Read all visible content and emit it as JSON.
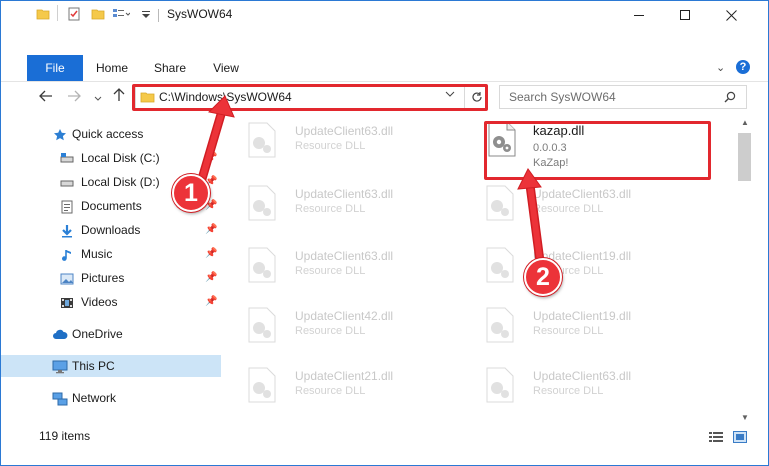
{
  "window": {
    "title": "SysWOW64",
    "controls": [
      "minimize",
      "maximize",
      "close"
    ]
  },
  "ribbon": {
    "tabs": [
      "File",
      "Home",
      "Share",
      "View"
    ]
  },
  "navigation": {
    "address": "C:\\Windows\\SysWOW64",
    "search_placeholder": "Search SysWOW64"
  },
  "sidebar": {
    "items": [
      {
        "label": "Quick access",
        "icon": "star-icon"
      },
      {
        "label": "Local Disk (C:)",
        "icon": "drive-icon"
      },
      {
        "label": "Local Disk (D:)",
        "icon": "drive-icon"
      },
      {
        "label": "Documents",
        "icon": "documents-icon"
      },
      {
        "label": "Downloads",
        "icon": "download-icon"
      },
      {
        "label": "Music",
        "icon": "music-icon"
      },
      {
        "label": "Pictures",
        "icon": "pictures-icon"
      },
      {
        "label": "Videos",
        "icon": "videos-icon"
      },
      {
        "label": "OneDrive",
        "icon": "cloud-icon"
      },
      {
        "label": "This PC",
        "icon": "computer-icon"
      },
      {
        "label": "Network",
        "icon": "network-icon"
      }
    ]
  },
  "files": [
    {
      "name": "UpdateClient63.dll",
      "desc": "Resource DLL"
    },
    {
      "name": "kazap.dll",
      "desc": "0.0.0.3",
      "desc2": "KaZap!"
    },
    {
      "name": "UpdateClient63.dll",
      "desc": "Resource DLL"
    },
    {
      "name": "UpdateClient63.dll",
      "desc": "Resource DLL"
    },
    {
      "name": "UpdateClient63.dll",
      "desc": "Resource DLL"
    },
    {
      "name": "UpdateClient19.dll",
      "desc": "Resource DLL"
    },
    {
      "name": "UpdateClient42.dll",
      "desc": "Resource DLL"
    },
    {
      "name": "UpdateClient19.dll",
      "desc": "Resource DLL"
    },
    {
      "name": "UpdateClient21.dll",
      "desc": "Resource DLL"
    },
    {
      "name": "UpdateClient63.dll",
      "desc": "Resource DLL"
    }
  ],
  "status": {
    "item_count": "119 items"
  },
  "callouts": [
    "1",
    "2"
  ],
  "colors": {
    "accent": "#1a6ed6",
    "highlight": "#e2282e",
    "callout": "#ec3339",
    "selected": "#cce4f7"
  }
}
